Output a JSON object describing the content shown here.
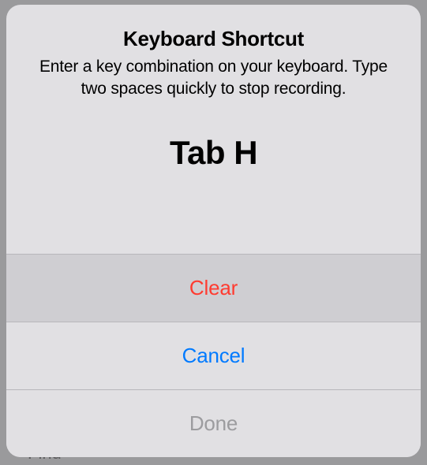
{
  "backdrop": {
    "partial_text": "Find"
  },
  "alert": {
    "title": "Keyboard Shortcut",
    "message": "Enter a key combination on your keyboard. Type two spaces quickly to stop recording.",
    "shortcut_value": "Tab H",
    "buttons": {
      "clear": "Clear",
      "cancel": "Cancel",
      "done": "Done"
    }
  }
}
